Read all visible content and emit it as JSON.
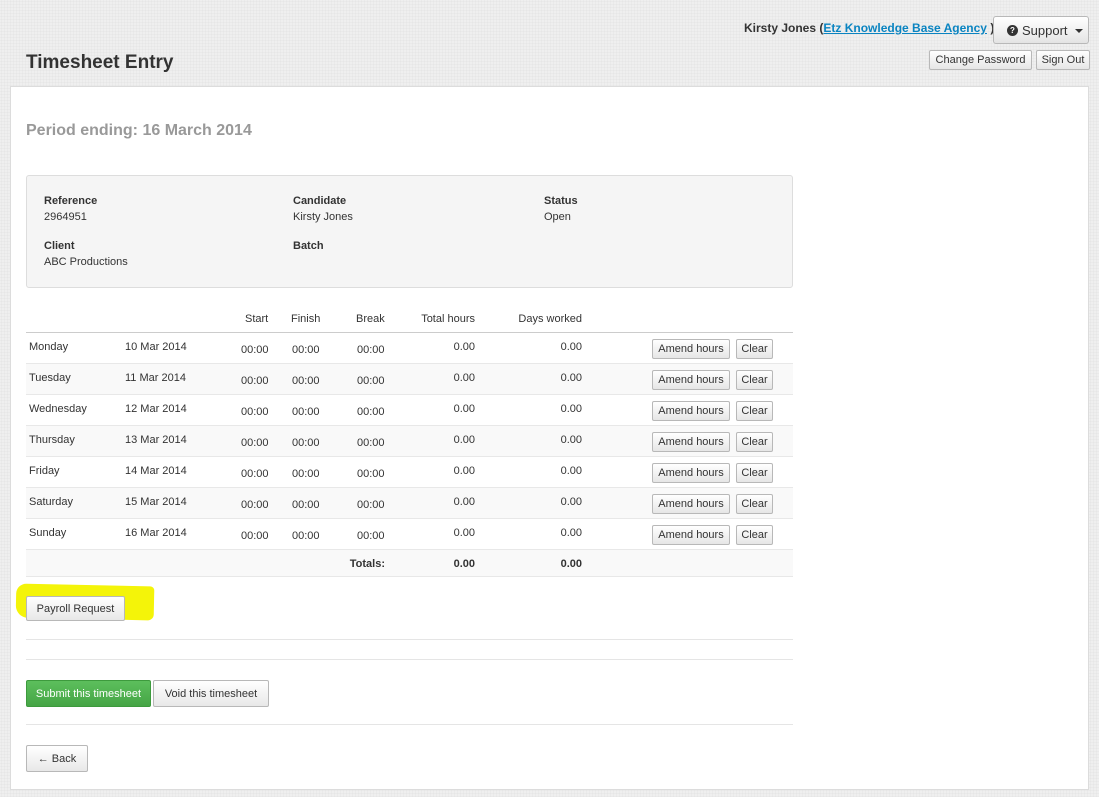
{
  "header": {
    "user_name": "Kirsty Jones",
    "paren_open": "(",
    "agency": "Etz Knowledge Base Agency",
    "paren_close": ")",
    "support_label": "Support",
    "change_password_label": "Change Password",
    "sign_out_label": "Sign Out",
    "page_title": "Timesheet Entry"
  },
  "period": {
    "label": "Period ending: 16 March 2014"
  },
  "info": {
    "reference_label": "Reference",
    "reference_value": "2964951",
    "candidate_label": "Candidate",
    "candidate_value": "Kirsty Jones",
    "status_label": "Status",
    "status_value": "Open",
    "client_label": "Client",
    "client_value": "ABC Productions",
    "batch_label": "Batch"
  },
  "table": {
    "headers": {
      "start": "Start",
      "finish": "Finish",
      "break": "Break",
      "total": "Total hours",
      "days": "Days worked"
    },
    "rows": [
      {
        "day": "Monday",
        "date": "10 Mar 2014",
        "start": "00:00",
        "finish": "00:00",
        "break": "00:00",
        "total": "0.00",
        "days": "0.00"
      },
      {
        "day": "Tuesday",
        "date": "11 Mar 2014",
        "start": "00:00",
        "finish": "00:00",
        "break": "00:00",
        "total": "0.00",
        "days": "0.00"
      },
      {
        "day": "Wednesday",
        "date": "12 Mar 2014",
        "start": "00:00",
        "finish": "00:00",
        "break": "00:00",
        "total": "0.00",
        "days": "0.00"
      },
      {
        "day": "Thursday",
        "date": "13 Mar 2014",
        "start": "00:00",
        "finish": "00:00",
        "break": "00:00",
        "total": "0.00",
        "days": "0.00"
      },
      {
        "day": "Friday",
        "date": "14 Mar 2014",
        "start": "00:00",
        "finish": "00:00",
        "break": "00:00",
        "total": "0.00",
        "days": "0.00"
      },
      {
        "day": "Saturday",
        "date": "15 Mar 2014",
        "start": "00:00",
        "finish": "00:00",
        "break": "00:00",
        "total": "0.00",
        "days": "0.00"
      },
      {
        "day": "Sunday",
        "date": "16 Mar 2014",
        "start": "00:00",
        "finish": "00:00",
        "break": "00:00",
        "total": "0.00",
        "days": "0.00"
      }
    ],
    "amend_label": "Amend hours",
    "clear_label": "Clear",
    "totals_label": "Totals:",
    "totals_hours": "0.00",
    "totals_days": "0.00"
  },
  "actions": {
    "payroll_label": "Payroll Request",
    "submit_label": "Submit this timesheet",
    "void_label": "Void this timesheet",
    "back_label": "← Back"
  },
  "colors": {
    "link": "#0a84c1",
    "submit_green": "#46a546",
    "highlight_yellow": "#f4f409"
  }
}
